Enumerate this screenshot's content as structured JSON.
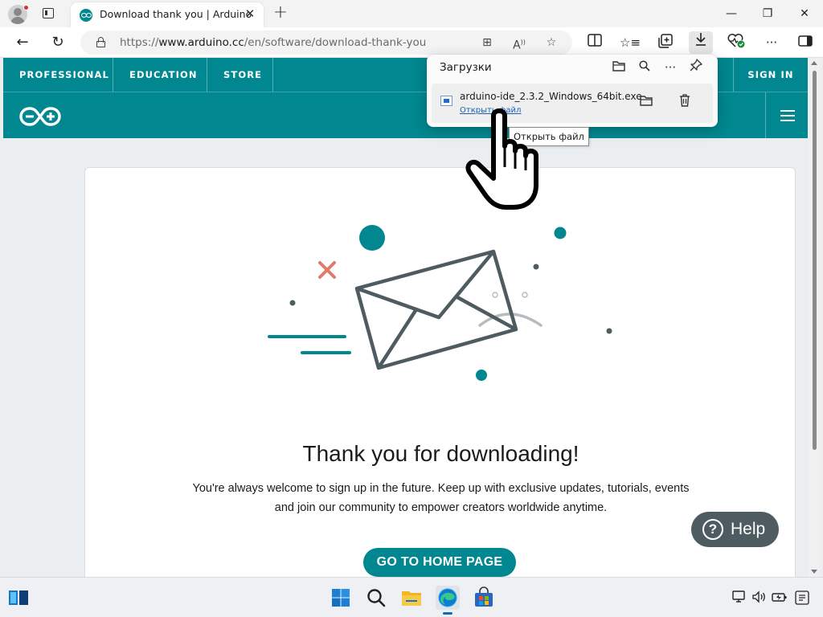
{
  "browser": {
    "tab_title": "Download thank you | Arduino",
    "tab_close": "✕",
    "new_tab": "+",
    "window_controls": {
      "minimize": "—",
      "maximize": "❐",
      "close": "✕"
    },
    "nav": {
      "back": "←",
      "reload": "↻"
    },
    "url_prefix": "https://",
    "url_host": "www.arduino.cc",
    "url_path": "/en/software/download-thank-you",
    "toolbar_icons": [
      "split-screen-icon",
      "favorites-icon",
      "collections-icon",
      "downloads-icon",
      "browser-essentials-icon",
      "more-icon",
      "sidebar-icon"
    ]
  },
  "site": {
    "brand_color": "#00878f",
    "topnav": [
      "PROFESSIONAL",
      "EDUCATION",
      "STORE"
    ],
    "signin": "SIGN IN",
    "card": {
      "title": "Thank you for downloading!",
      "text": "You're always welcome to sign up in the future. Keep up with exclusive updates, tutorials, events and join our community to empower creators worldwide anytime.",
      "button": "GO TO HOME PAGE"
    },
    "help": {
      "icon": "?",
      "label": "Help"
    }
  },
  "downloads_panel": {
    "title": "Загрузки",
    "header_icons": [
      "folder-icon",
      "search-icon",
      "more-icon",
      "pin-icon"
    ],
    "item": {
      "file_name": "arduino-ide_2.3.2_Windows_64bit.exe",
      "open_link": "Открыть файл"
    },
    "tooltip": "Открыть файл"
  },
  "taskbar": {
    "apps": [
      "widgets-icon",
      "start-icon",
      "search-icon",
      "file-explorer-icon",
      "edge-icon",
      "store-icon"
    ],
    "tray": [
      "network-icon",
      "volume-icon",
      "battery-icon",
      "notifications-icon"
    ]
  }
}
